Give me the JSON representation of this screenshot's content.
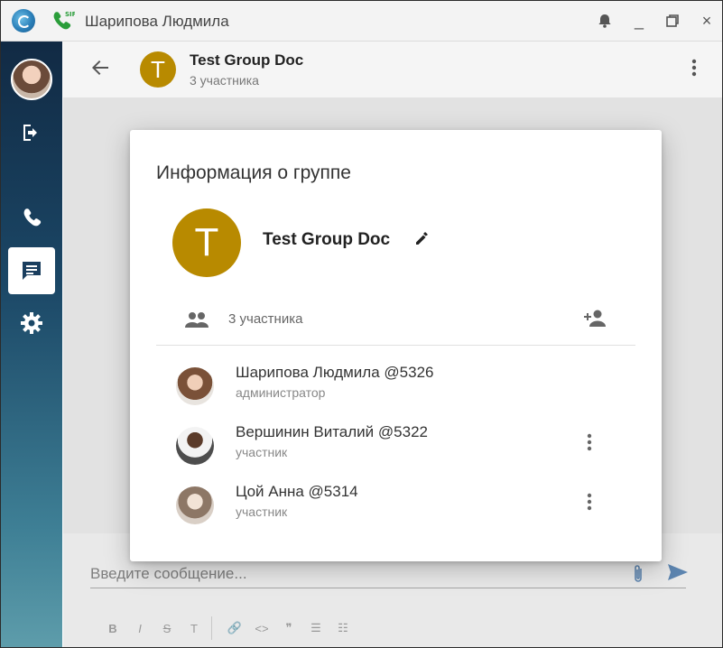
{
  "window": {
    "title": "Шарипова Людмила",
    "buttons": {
      "alarm": "🔔",
      "minimize": "_",
      "maximize": "☐",
      "close": "×"
    }
  },
  "chat": {
    "header": {
      "avatar_letter": "T",
      "name": "Test Group Doc",
      "subtitle": "3 участника"
    },
    "composer": {
      "placeholder": "Введите сообщение...",
      "format_buttons": [
        "B",
        "I",
        "S",
        "T",
        "🔗",
        "<>",
        "❞",
        "☰",
        "☷"
      ]
    }
  },
  "modal": {
    "title": "Информация о группе",
    "group": {
      "avatar_letter": "T",
      "name": "Test Group Doc",
      "avatar_color": "#b88a00"
    },
    "members_count": "3 участника",
    "members": [
      {
        "name": "Шарипова Людмила @5326",
        "role": "администратор",
        "avatar_hint": "woman-long-hair"
      },
      {
        "name": "Вершинин Виталий @5322",
        "role": "участник",
        "avatar_hint": "man-white-shirt"
      },
      {
        "name": "Цой Анна @5314",
        "role": "участник",
        "avatar_hint": "woman-light"
      }
    ]
  },
  "colors": {
    "sidebar_top": "#112a44",
    "sidebar_bottom": "#5e9dab",
    "accent_blue": "#3a6fa8",
    "group_avatar": "#b88a00"
  },
  "icons": {
    "sidebar": [
      "user-avatar",
      "logout-icon",
      "phone-icon",
      "chat-icon",
      "settings-icon"
    ]
  }
}
